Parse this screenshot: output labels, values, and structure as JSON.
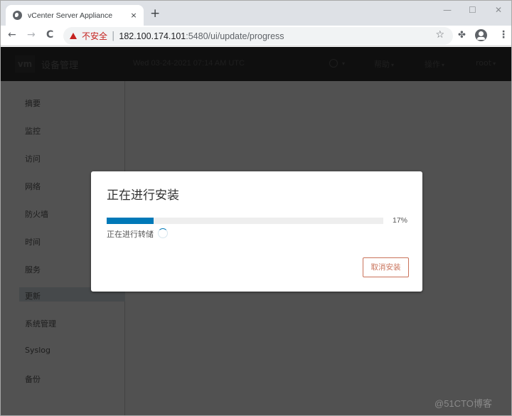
{
  "browser": {
    "tab_title": "vCenter Server Appliance",
    "tab_close": "×",
    "new_tab": "+",
    "window_controls": {
      "minimize": "—",
      "maximize": "☐",
      "close": "✕"
    },
    "nav": {
      "back": "←",
      "forward": "→",
      "reload": "C"
    },
    "security_label": "不安全",
    "separator": "|",
    "url_host": "182.100.174.101",
    "url_rest": ":5480/ui/update/progress",
    "icons": {
      "star": "☆",
      "extensions": "✤",
      "menu": "⋮"
    }
  },
  "app": {
    "logo": "vm",
    "brand": "设备管理",
    "datetime": "Wed 03-24-2021 07:14 AM UTC",
    "header_menus": [
      {
        "label": "帮助"
      },
      {
        "label": "操作"
      },
      {
        "label": "root"
      }
    ],
    "caret": "▾",
    "sidebar": {
      "items": [
        {
          "label": "摘要"
        },
        {
          "label": "监控"
        },
        {
          "label": "访问"
        },
        {
          "label": "网络"
        },
        {
          "label": "防火墙"
        },
        {
          "label": "时间"
        },
        {
          "label": "服务"
        },
        {
          "label": "更新",
          "active": true
        },
        {
          "label": "系统管理"
        },
        {
          "label": "Syslog"
        },
        {
          "label": "备份"
        }
      ]
    }
  },
  "modal": {
    "title": "正在进行安装",
    "progress_percent": 17,
    "progress_label": "17%",
    "status": "正在进行转储",
    "cancel_label": "取消安装"
  },
  "colors": {
    "progress": "#0079b8",
    "cancel": "#c9725a",
    "warning": "#c5221f"
  },
  "watermark": "@51CTO博客"
}
